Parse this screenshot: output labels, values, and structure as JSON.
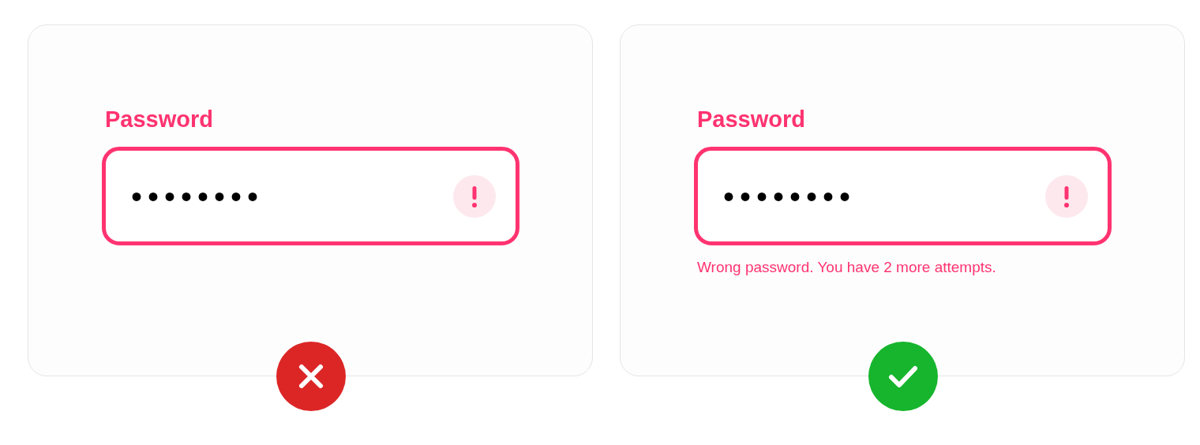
{
  "cards": [
    {
      "kind": "wrong",
      "label": "Password",
      "value": "••••••••"
    },
    {
      "kind": "right",
      "label": "Password",
      "value": "••••••••",
      "error": "Wrong password. You have 2 more attempts."
    }
  ]
}
